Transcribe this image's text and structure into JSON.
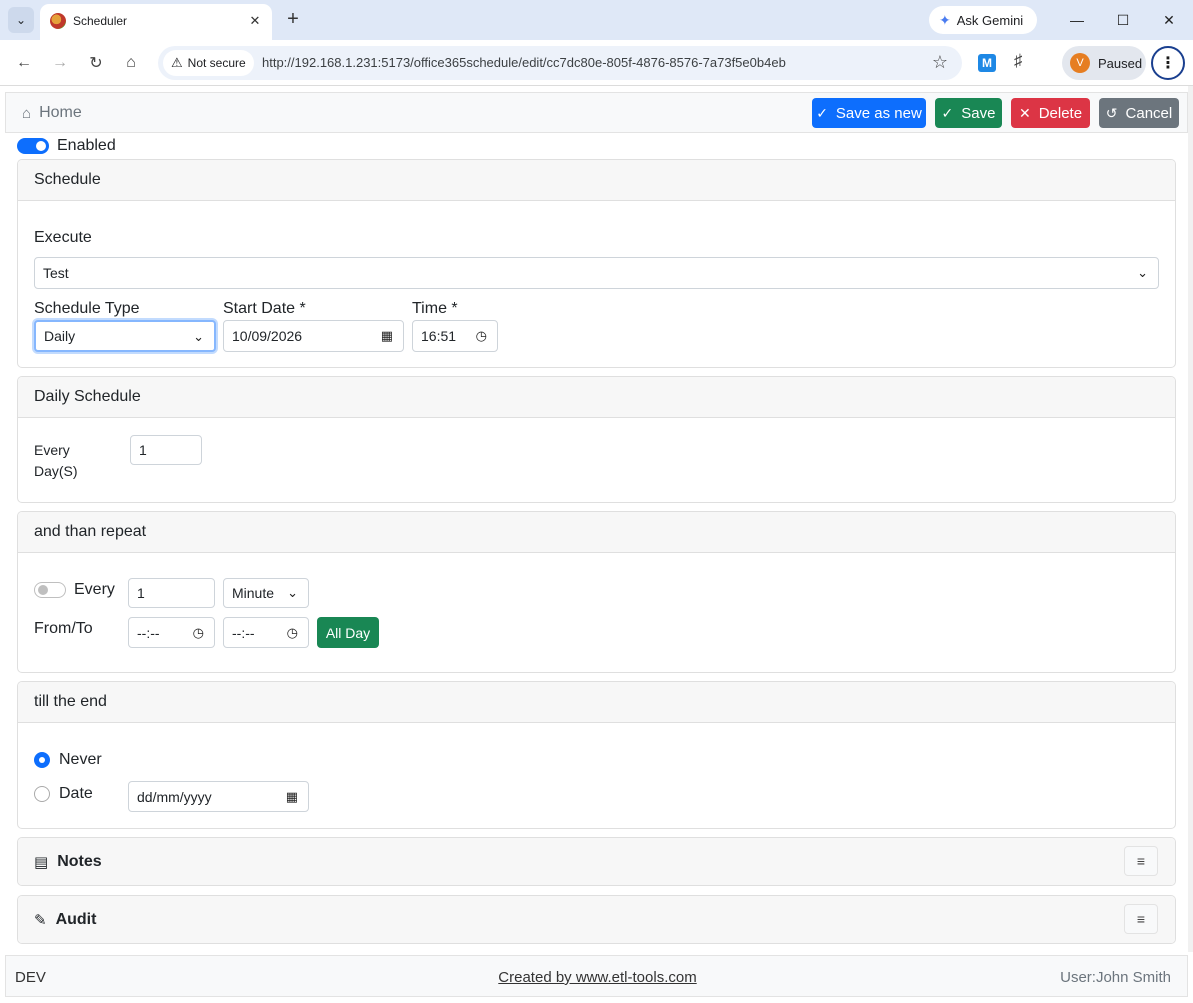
{
  "browser": {
    "tab_title": "Scheduler",
    "gemini_label": "Ask Gemini",
    "security_label": "Not secure",
    "url": "http://192.168.1.231:5173/office365schedule/edit/cc7dc80e-805f-4876-8576-7a73f5e0b4eb",
    "profile_initial": "V",
    "profile_status": "Paused"
  },
  "header": {
    "home_label": "Home",
    "save_as_new_label": "Save as new",
    "save_label": "Save",
    "delete_label": "Delete",
    "cancel_label": "Cancel"
  },
  "enabled": {
    "label": "Enabled",
    "checked": true
  },
  "schedule": {
    "title": "Schedule",
    "execute_label": "Execute",
    "execute_value": "Test",
    "type_label": "Schedule Type",
    "type_value": "Daily",
    "start_date_label": "Start Date *",
    "start_date_value": "10/09/2026",
    "time_label": "Time *",
    "time_value": "16:51"
  },
  "daily": {
    "title": "Daily Schedule",
    "every_label_1": "Every",
    "every_label_2": "Day(S)",
    "every_value": "1"
  },
  "repeat": {
    "title": "and than repeat",
    "every_label": "Every",
    "every_value": "1",
    "unit_value": "Minute",
    "fromto_label": "From/To",
    "from_value": "--:--",
    "to_value": "--:--",
    "all_day_label": "All Day"
  },
  "end": {
    "title": "till the end",
    "never_label": "Never",
    "date_label": "Date",
    "date_placeholder": "dd/mm/yyyy"
  },
  "notes": {
    "title": "Notes"
  },
  "audit": {
    "title": "Audit"
  },
  "footer": {
    "env": "DEV",
    "credit": "Created by www.etl-tools.com",
    "user": "User:John Smith"
  },
  "colors": {
    "primary": "#0d6efd",
    "success": "#198754",
    "danger": "#dc3545",
    "secondary": "#6c757d"
  }
}
